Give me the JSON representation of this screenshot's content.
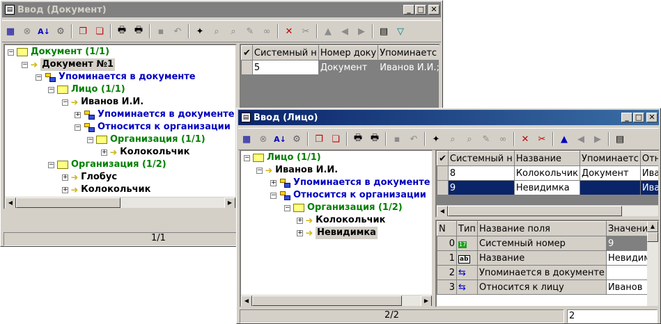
{
  "doc_window": {
    "title": "Ввод (Документ)",
    "controls": {
      "minimize": "_",
      "maximize": "□",
      "close": "✕"
    },
    "tree": [
      {
        "label": "Документ (1/1)",
        "color": "green",
        "kind": "folder",
        "exp": "−"
      },
      {
        "label": "Документ №1",
        "color": "black",
        "kind": "arrow",
        "exp": "−",
        "selected": true
      },
      {
        "label": "Упоминается в документе",
        "color": "blue",
        "kind": "link",
        "exp": "−"
      },
      {
        "label": "Лицо (1/1)",
        "color": "green",
        "kind": "folder",
        "exp": "−"
      },
      {
        "label": "Иванов И.И.",
        "color": "black",
        "kind": "arrow",
        "exp": "−"
      },
      {
        "label": "Упоминается в документе",
        "color": "blue",
        "kind": "link",
        "exp": "+"
      },
      {
        "label": "Относится к организации",
        "color": "blue",
        "kind": "link",
        "exp": "−"
      },
      {
        "label": "Организация (1/1)",
        "color": "green",
        "kind": "folder",
        "exp": "−"
      },
      {
        "label": "Колокольчик",
        "color": "black",
        "kind": "arrow",
        "exp": "+"
      },
      {
        "label": "Организация (1/2)",
        "color": "green",
        "kind": "folder",
        "exp": "−"
      },
      {
        "label": "Глобус",
        "color": "black",
        "kind": "arrow",
        "exp": "+"
      },
      {
        "label": "Колокольчик",
        "color": "black",
        "kind": "arrow",
        "exp": "+"
      }
    ],
    "grid": {
      "columns": [
        "Системный н",
        "Номер доку",
        "Упоминаетс"
      ],
      "rows": [
        [
          "5",
          "Документ",
          "Иванов И.И.;"
        ]
      ]
    },
    "status": "1/1"
  },
  "person_window": {
    "title": "Ввод (Лицо)",
    "controls": {
      "minimize": "_",
      "maximize": "□",
      "close": "✕"
    },
    "tree": [
      {
        "label": "Лицо (1/1)",
        "color": "green",
        "kind": "folder",
        "exp": "−"
      },
      {
        "label": "Иванов И.И.",
        "color": "black",
        "kind": "arrow",
        "exp": "−"
      },
      {
        "label": "Упоминается в документе",
        "color": "blue",
        "kind": "link",
        "exp": "+"
      },
      {
        "label": "Относится к организации",
        "color": "blue",
        "kind": "link",
        "exp": "−"
      },
      {
        "label": "Организация (1/2)",
        "color": "green",
        "kind": "folder",
        "exp": "−"
      },
      {
        "label": "Колокольчик",
        "color": "black",
        "kind": "arrow",
        "exp": "+"
      },
      {
        "label": "Невидимка",
        "color": "black",
        "kind": "arrow",
        "exp": "+",
        "selected": true
      }
    ],
    "grid": {
      "columns": [
        "Системный н",
        "Название",
        "Упоминаетс",
        "Отно"
      ],
      "rows": [
        [
          "8",
          "Колокольчик",
          "Документ",
          "Иван"
        ],
        [
          "9",
          "Невидимка",
          "",
          "Иван"
        ]
      ]
    },
    "fields": {
      "columns": [
        "N",
        "Тип",
        "Название поля",
        "Значение"
      ],
      "rows": [
        {
          "n": "0",
          "type": "17",
          "name": "Системный номер",
          "value": "9"
        },
        {
          "n": "1",
          "type": "ab",
          "name": "Название",
          "value": "Невидимк"
        },
        {
          "n": "2",
          "type": "link",
          "name": "Упоминается в документе",
          "value": ""
        },
        {
          "n": "3",
          "type": "link",
          "name": "Относится к лицу",
          "value": "Иванов"
        }
      ]
    },
    "status": "2/2",
    "status_right": "2"
  }
}
